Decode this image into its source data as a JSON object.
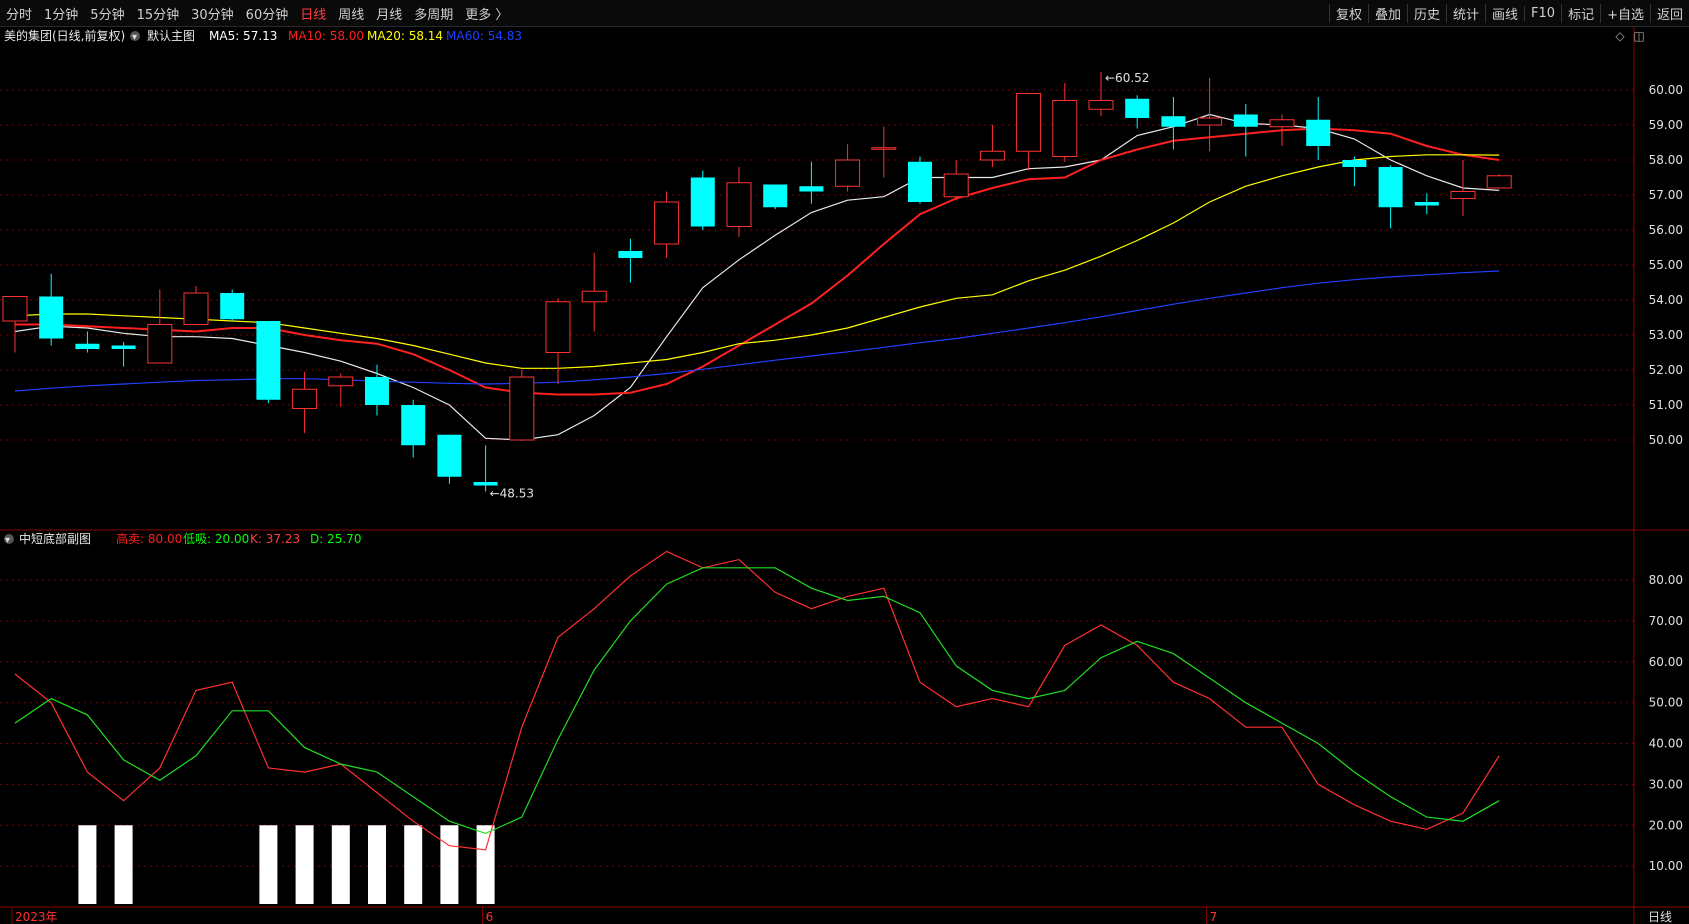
{
  "menu": [
    "分时",
    "1分钟",
    "5分钟",
    "15分钟",
    "30分钟",
    "60分钟",
    "日线",
    "周线",
    "月线",
    "多周期",
    "更多 〉"
  ],
  "menu_active": 6,
  "tools": [
    "复权",
    "叠加",
    "历史",
    "统计",
    "画线",
    "F10",
    "标记",
    "+自选",
    "返回"
  ],
  "main_panel": {
    "stock_title": "美的集团(日线,前复权)",
    "main_label": "默认主图",
    "ma_legend": [
      {
        "label": "MA5: 57.13",
        "color": "#ffffff"
      },
      {
        "label": "MA10: 58.00",
        "color": "#ff2020"
      },
      {
        "label": "MA20: 58.14",
        "color": "#ffff00"
      },
      {
        "label": "MA60: 54.83",
        "color": "#2040ff"
      }
    ]
  },
  "sub_panel": {
    "title": "中短底部副图",
    "legend": [
      {
        "label": "高卖: 80.00",
        "color": "#ff2020"
      },
      {
        "label": "低吸: 20.00",
        "color": "#00ff00"
      },
      {
        "label": "K: 37.23",
        "color": "#ff4040"
      },
      {
        "label": "D: 25.70",
        "color": "#00ff00"
      }
    ]
  },
  "x_labels": [
    {
      "label": "2023年",
      "index": 0
    },
    {
      "label": "6",
      "index": 13
    },
    {
      "label": "7",
      "index": 33
    }
  ],
  "bottom_right_label": "日线",
  "chart_data": [
    {
      "type": "candlestick",
      "ylim": [
        47.8,
        61.0
      ],
      "yticks": [
        "50.00",
        "51.00",
        "52.00",
        "53.00",
        "54.00",
        "55.00",
        "56.00",
        "57.00",
        "58.00",
        "59.00",
        "60.00"
      ],
      "annotations": [
        {
          "label": "60.52",
          "index": 30,
          "value": 60.52
        },
        {
          "label": "48.53",
          "index": 13,
          "value": 48.53
        }
      ],
      "candles": [
        {
          "o": 53.4,
          "h": 54.1,
          "l": 52.5,
          "c": 54.1
        },
        {
          "o": 54.1,
          "h": 54.75,
          "l": 52.7,
          "c": 52.9
        },
        {
          "o": 52.75,
          "h": 53.1,
          "l": 52.5,
          "c": 52.6
        },
        {
          "o": 52.7,
          "h": 52.8,
          "l": 52.1,
          "c": 52.6
        },
        {
          "o": 52.2,
          "h": 54.3,
          "l": 52.2,
          "c": 53.3
        },
        {
          "o": 53.3,
          "h": 54.4,
          "l": 53.3,
          "c": 54.2
        },
        {
          "o": 54.2,
          "h": 54.3,
          "l": 53.4,
          "c": 53.45
        },
        {
          "o": 53.4,
          "h": 53.4,
          "l": 51.05,
          "c": 51.15
        },
        {
          "o": 50.9,
          "h": 51.95,
          "l": 50.2,
          "c": 51.45
        },
        {
          "o": 51.55,
          "h": 51.9,
          "l": 50.95,
          "c": 51.8
        },
        {
          "o": 51.8,
          "h": 52.15,
          "l": 50.7,
          "c": 51.0
        },
        {
          "o": 51.0,
          "h": 51.15,
          "l": 49.5,
          "c": 49.85
        },
        {
          "o": 50.15,
          "h": 50.15,
          "l": 48.75,
          "c": 48.95
        },
        {
          "o": 48.8,
          "h": 49.85,
          "l": 48.53,
          "c": 48.7
        },
        {
          "o": 50.0,
          "h": 52.0,
          "l": 50.0,
          "c": 51.8
        },
        {
          "o": 52.5,
          "h": 54.05,
          "l": 51.6,
          "c": 53.95
        },
        {
          "o": 53.95,
          "h": 55.35,
          "l": 53.1,
          "c": 54.25
        },
        {
          "o": 55.4,
          "h": 55.75,
          "l": 54.5,
          "c": 55.2
        },
        {
          "o": 55.6,
          "h": 57.1,
          "l": 55.2,
          "c": 56.8
        },
        {
          "o": 57.5,
          "h": 57.7,
          "l": 56.0,
          "c": 56.1
        },
        {
          "o": 56.1,
          "h": 57.8,
          "l": 55.8,
          "c": 57.35
        },
        {
          "o": 57.3,
          "h": 57.3,
          "l": 56.6,
          "c": 56.65
        },
        {
          "o": 57.25,
          "h": 57.95,
          "l": 56.75,
          "c": 57.1
        },
        {
          "o": 57.25,
          "h": 58.45,
          "l": 57.1,
          "c": 58.0
        },
        {
          "o": 58.35,
          "h": 58.95,
          "l": 57.5,
          "c": 58.35
        },
        {
          "o": 57.95,
          "h": 58.1,
          "l": 56.75,
          "c": 56.8
        },
        {
          "o": 56.95,
          "h": 58.0,
          "l": 56.85,
          "c": 57.6
        },
        {
          "o": 58.0,
          "h": 59.0,
          "l": 57.8,
          "c": 58.25
        },
        {
          "o": 58.25,
          "h": 59.6,
          "l": 57.7,
          "c": 59.9
        },
        {
          "o": 58.1,
          "h": 60.2,
          "l": 57.95,
          "c": 59.7
        },
        {
          "o": 59.45,
          "h": 60.52,
          "l": 59.25,
          "c": 59.7
        },
        {
          "o": 59.75,
          "h": 59.85,
          "l": 58.9,
          "c": 59.2
        },
        {
          "o": 59.25,
          "h": 59.8,
          "l": 58.3,
          "c": 58.95
        },
        {
          "o": 59.0,
          "h": 60.35,
          "l": 58.25,
          "c": 59.2
        },
        {
          "o": 59.3,
          "h": 59.6,
          "l": 58.1,
          "c": 58.95
        },
        {
          "o": 58.95,
          "h": 59.3,
          "l": 58.4,
          "c": 59.15
        },
        {
          "o": 59.15,
          "h": 59.8,
          "l": 58.0,
          "c": 58.4
        },
        {
          "o": 58.0,
          "h": 58.1,
          "l": 57.25,
          "c": 57.8
        },
        {
          "o": 57.8,
          "h": 57.85,
          "l": 56.05,
          "c": 56.65
        },
        {
          "o": 56.8,
          "h": 57.05,
          "l": 56.45,
          "c": 56.7
        },
        {
          "o": 56.9,
          "h": 58.0,
          "l": 56.4,
          "c": 57.1
        },
        {
          "o": 57.2,
          "h": 57.6,
          "l": 57.2,
          "c": 57.55
        }
      ],
      "series": [
        {
          "name": "MA5",
          "color": "#e8e8e8",
          "values": [
            53.1,
            53.25,
            53.2,
            53.05,
            52.95,
            52.95,
            52.9,
            52.7,
            52.5,
            52.25,
            51.9,
            51.5,
            51.0,
            50.05,
            50.0,
            50.15,
            50.7,
            51.5,
            52.95,
            54.35,
            55.15,
            55.85,
            56.5,
            56.85,
            56.95,
            57.5,
            57.5,
            57.5,
            57.75,
            57.8,
            58.0,
            58.7,
            58.95,
            59.3,
            59.05,
            59.0,
            58.9,
            58.6,
            58.0,
            57.55,
            57.2,
            57.13
          ]
        },
        {
          "name": "MA10",
          "color": "#ff2020",
          "values": [
            53.3,
            53.3,
            53.25,
            53.2,
            53.15,
            53.1,
            53.2,
            53.2,
            53.0,
            52.85,
            52.75,
            52.45,
            52.0,
            51.5,
            51.35,
            51.3,
            51.3,
            51.35,
            51.6,
            52.1,
            52.7,
            53.3,
            53.9,
            54.7,
            55.6,
            56.45,
            56.9,
            57.2,
            57.45,
            57.5,
            58.0,
            58.3,
            58.55,
            58.65,
            58.75,
            58.85,
            58.9,
            58.85,
            58.75,
            58.4,
            58.15,
            58.0
          ]
        },
        {
          "name": "MA20",
          "color": "#ffff00",
          "values": [
            53.55,
            53.6,
            53.6,
            53.55,
            53.5,
            53.45,
            53.4,
            53.35,
            53.2,
            53.05,
            52.9,
            52.7,
            52.45,
            52.2,
            52.05,
            52.05,
            52.1,
            52.2,
            52.3,
            52.5,
            52.75,
            52.85,
            53.0,
            53.2,
            53.5,
            53.8,
            54.05,
            54.15,
            54.55,
            54.85,
            55.25,
            55.7,
            56.2,
            56.8,
            57.25,
            57.55,
            57.8,
            58.0,
            58.1,
            58.15,
            58.15,
            58.14
          ]
        },
        {
          "name": "MA60",
          "color": "#2040ff",
          "values": [
            51.4,
            51.48,
            51.55,
            51.6,
            51.65,
            51.7,
            51.72,
            51.75,
            51.75,
            51.72,
            51.68,
            51.65,
            51.62,
            51.6,
            51.62,
            51.65,
            51.72,
            51.8,
            51.9,
            52.02,
            52.15,
            52.28,
            52.4,
            52.52,
            52.65,
            52.78,
            52.9,
            53.05,
            53.2,
            53.35,
            53.52,
            53.7,
            53.88,
            54.05,
            54.2,
            54.35,
            54.48,
            54.58,
            54.66,
            54.72,
            54.78,
            54.83
          ]
        }
      ]
    },
    {
      "type": "line",
      "title": "中短底部副图",
      "ylim": [
        0,
        92
      ],
      "yticks": [
        "10.00",
        "20.00",
        "30.00",
        "40.00",
        "50.00",
        "60.00",
        "70.00",
        "80.00"
      ],
      "series": [
        {
          "name": "K",
          "color": "#ff3030",
          "values": [
            57,
            50,
            33,
            26,
            34,
            53,
            55,
            34,
            33,
            35,
            28,
            21,
            15,
            14,
            44,
            66,
            73,
            81,
            87,
            83,
            85,
            77,
            73,
            76,
            78,
            55,
            49,
            51,
            49,
            64,
            69,
            64,
            55,
            51,
            44,
            44,
            30,
            25,
            21,
            19,
            23,
            37
          ]
        },
        {
          "name": "D",
          "color": "#22dd22",
          "values": [
            45,
            51,
            47,
            36,
            31,
            37,
            48,
            48,
            39,
            35,
            33,
            27,
            21,
            18,
            22,
            41,
            58,
            70,
            79,
            83,
            83,
            83,
            78,
            75,
            76,
            72,
            59,
            53,
            51,
            53,
            61,
            65,
            62,
            56,
            50,
            45,
            40,
            33,
            27,
            22,
            21,
            26
          ]
        }
      ],
      "bars_value": 20,
      "bar_indices": [
        2,
        3,
        7,
        8,
        9,
        10,
        11,
        12,
        13
      ]
    }
  ]
}
